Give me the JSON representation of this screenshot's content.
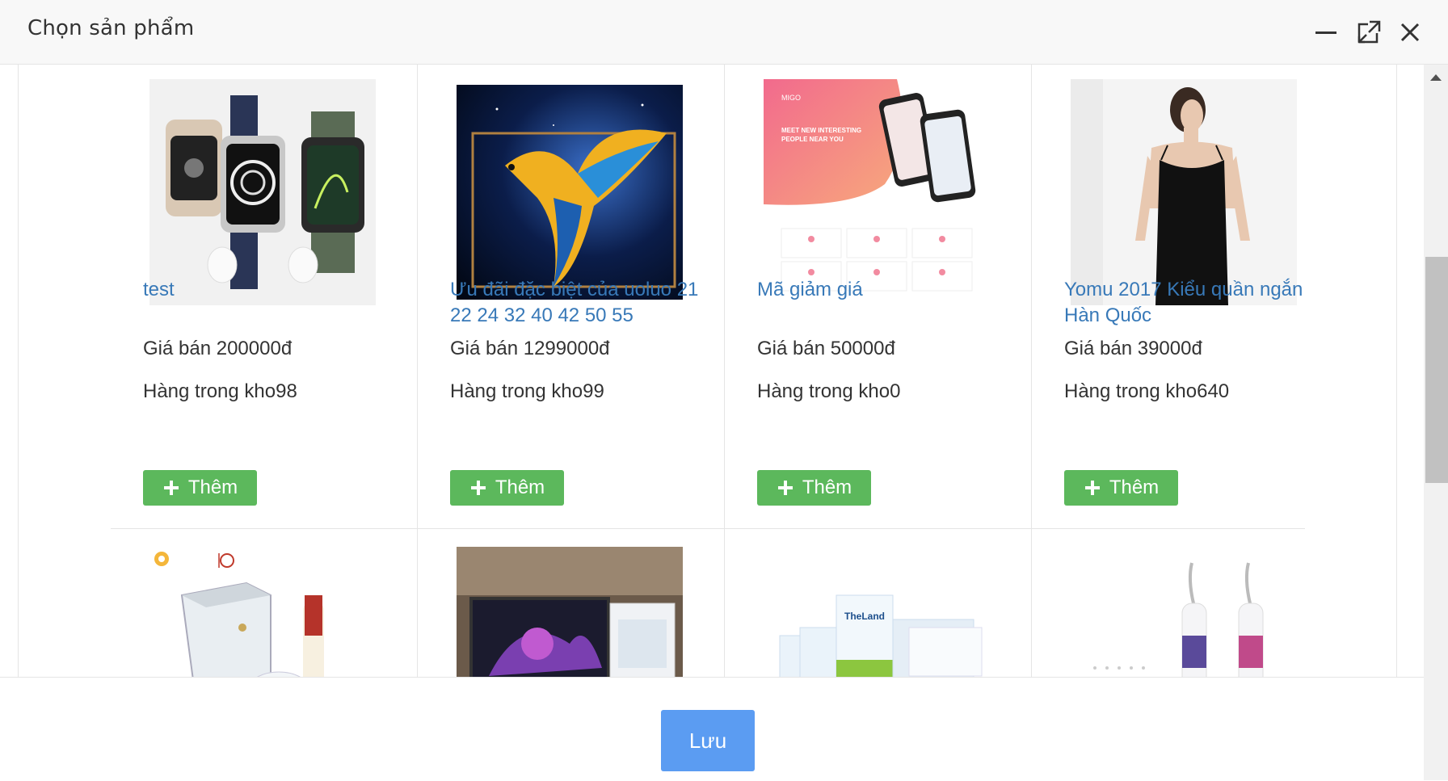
{
  "dialog": {
    "title": "Chọn sản phẩm",
    "minimize_icon": "minimize-icon",
    "maximize_icon": "maximize-icon",
    "close_icon": "close-icon"
  },
  "products": [
    {
      "name": "test",
      "price": "Giá bán 200000đ",
      "stock": "Hàng trong kho98",
      "add_label": "Thêm",
      "image": "smartwatch-and-earbuds"
    },
    {
      "name": "Ưu đãi đặc biệt của uoluo 21 22 24 32 40 42 50 55",
      "price": "Giá bán 1299000đ",
      "stock": "Hàng trong kho99",
      "add_label": "Thêm",
      "image": "tv-with-parrot"
    },
    {
      "name": "Mã giảm giá",
      "price": "Giá bán 50000đ",
      "stock": "Hàng trong kho0",
      "add_label": "Thêm",
      "image": "migo-app-mockup",
      "image_text": {
        "brand": "MIGO",
        "headline1": "MEET NEW INTERESTING",
        "headline2": "PEOPLE NEAR YOU"
      }
    },
    {
      "name": "Yomu 2017 Kiểu quần ngắn Hàn Quốc",
      "price": "Giá bán 39000đ",
      "stock": "Hàng trong kho640",
      "add_label": "Thêm",
      "image": "woman-black-tank-top"
    },
    {
      "image": "glass-container-and-bottle"
    },
    {
      "image": "monitor-and-pc-case"
    },
    {
      "image": "milk-cartons",
      "image_text": {
        "brand": "TheLand"
      }
    },
    {
      "image": "water-flossers"
    }
  ],
  "footer": {
    "save_label": "Lưu"
  },
  "colors": {
    "link": "#3879b8",
    "add_button": "#5cb85c",
    "save_button": "#5b9cf2"
  }
}
